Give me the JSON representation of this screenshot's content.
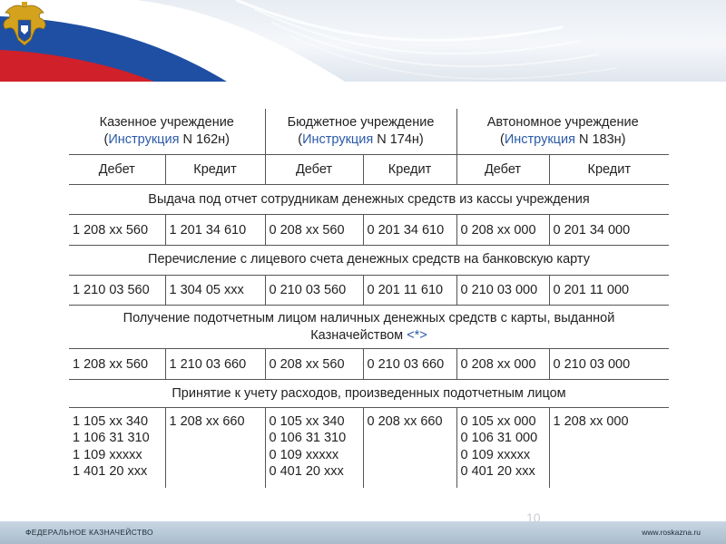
{
  "header": {
    "emblem_icon": "double-headed-eagle-emblem",
    "accent_colors": {
      "flag_white": "#ffffff",
      "flag_blue": "#1f4fa3",
      "flag_red": "#d0202a",
      "link_blue": "#2a5aa8"
    }
  },
  "table": {
    "columns": [
      {
        "title": "Казенное учреждение",
        "instr_open": "(",
        "instr_link": "Инструкция",
        "instr_rest": " N 162н)"
      },
      {
        "title": "Бюджетное учреждение",
        "instr_open": "(",
        "instr_link": "Инструкция",
        "instr_rest": " N 174н)"
      },
      {
        "title": "Автономное учреждение",
        "instr_open": "(",
        "instr_link": "Инструкция",
        "instr_rest": " N 183н)"
      }
    ],
    "sub_headers": [
      "Дебет",
      "Кредит",
      "Дебет",
      "Кредит",
      "Дебет",
      "Кредит"
    ],
    "sections": [
      {
        "title": "Выдача под отчет сотрудникам денежных средств из кассы учреждения",
        "values": [
          "1 208 xx 560",
          "1 201 34 610",
          "0 208 xx 560",
          "0 201 34 610",
          "0 208 xx 000",
          "0 201 34 000"
        ]
      },
      {
        "title": "Перечисление с лицевого счета денежных средств на банковскую карту",
        "values": [
          "1 210 03 560",
          "1 304 05 xxx",
          "0 210 03 560",
          "0 201 11 610",
          "0 210 03 000",
          "0 201 11 000"
        ]
      },
      {
        "title_line1": "Получение подотчетным лицом наличных денежных средств с карты, выданной",
        "title_line2": "Казначейством ",
        "title_ref": "<*>",
        "values": [
          "1 208 xx 560",
          "1 210 03 660",
          "0 208 xx 560",
          "0 210 03 660",
          "0 208 xx 000",
          "0 210 03 000"
        ]
      },
      {
        "title": "Принятие к учету расходов, произведенных подотчетным лицом",
        "multi_values": [
          [
            "1 105 xx 340",
            "1 106 31 310",
            "1 109 xxxxx",
            "1 401 20 xxx"
          ],
          [
            "1 208 xx 660"
          ],
          [
            "0 105 xx 340",
            "0 106 31 310",
            "0 109 xxxxx",
            "0 401 20 xxx"
          ],
          [
            "0 208 xx 660"
          ],
          [
            "0 105 xx 000",
            "0 106 31 000",
            "0 109 xxxxx",
            "0 401 20 xxx"
          ],
          [
            "1 208 xx 000"
          ]
        ]
      }
    ]
  },
  "footer": {
    "left": "ФЕДЕРАЛЬНОЕ КАЗНАЧЕЙСТВО",
    "right": "www.roskazna.ru",
    "page_number": "10"
  }
}
